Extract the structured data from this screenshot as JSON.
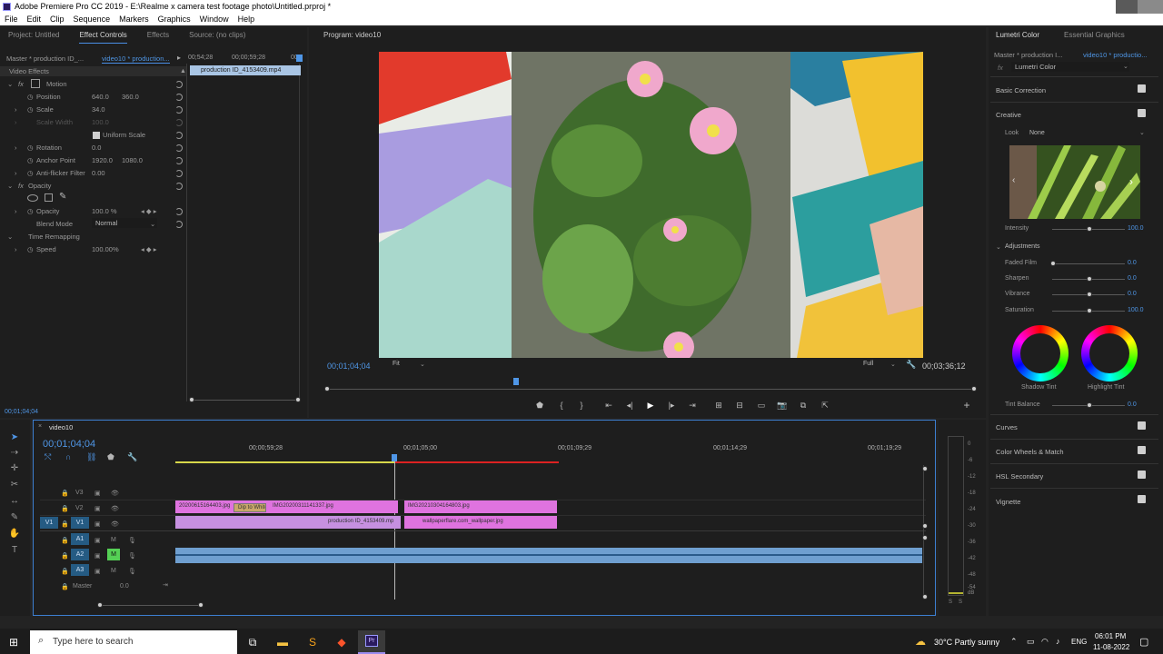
{
  "window": {
    "title": "Adobe Premiere Pro CC 2019 - E:\\Realme x camera test footage photo\\Untitled.prproj *"
  },
  "menu": [
    "File",
    "Edit",
    "Clip",
    "Sequence",
    "Markers",
    "Graphics",
    "Window",
    "Help"
  ],
  "left_panel": {
    "tabs": [
      "Project: Untitled",
      "Effect Controls",
      "Effects",
      "Source: (no clips)"
    ],
    "master": "Master * production ID_...",
    "sequence": "video10 * production...",
    "ruler": [
      "00;54;28",
      "00;00;59;28",
      "00"
    ],
    "clip_name": "production ID_4153409.mp4",
    "section": "Video Effects",
    "fx_motion": "Motion",
    "position_label": "Position",
    "position_x": "640.0",
    "position_y": "360.0",
    "scale_label": "Scale",
    "scale_val": "34.0",
    "scale_width_label": "Scale Width",
    "scale_width_val": "100.0",
    "uniform_scale": "Uniform Scale",
    "rotation_label": "Rotation",
    "rotation_val": "0.0",
    "anchor_label": "Anchor Point",
    "anchor_x": "1920.0",
    "anchor_y": "1080.0",
    "flicker_label": "Anti-flicker Filter",
    "flicker_val": "0.00",
    "fx_opacity": "Opacity",
    "opacity_label": "Opacity",
    "opacity_val": "100.0 %",
    "blend_label": "Blend Mode",
    "blend_val": "Normal",
    "time_remap": "Time Remapping",
    "speed_label": "Speed",
    "speed_val": "100.00%",
    "timecode": "00;01;04;04"
  },
  "program": {
    "title": "Program: video10",
    "timecode": "00;01;04;04",
    "fit": "Fit",
    "quality": "Full",
    "duration": "00;03;36;12"
  },
  "timeline": {
    "seq_tab": "video10",
    "timecode": "00;01;04;04",
    "ruler": [
      "00;00;59;28",
      "00;01;05;00",
      "00;01;09;29",
      "00;01;14;29",
      "00;01;19;29"
    ],
    "tracks": [
      "V3",
      "V2",
      "V1",
      "A1",
      "A2",
      "A3"
    ],
    "src_v1": "V1",
    "master_label": "Master",
    "master_val": "0.0",
    "clips": {
      "v2a": "20200615164403.jpg",
      "v2b": "Dip to White",
      "v2c": "IMG20200311141337.jpg",
      "v2d": "IMG20210304164803.jpg",
      "v1a": "production ID_4153409.mp",
      "v1b": "wallpaperflare.com_wallpaper.jpg"
    },
    "meter_scale": [
      "0",
      "-6",
      "-12",
      "-18",
      "-24",
      "-30",
      "-36",
      "-42",
      "-48",
      "-54",
      "dB"
    ],
    "meter_solo": [
      "S",
      "S"
    ]
  },
  "lumetri": {
    "tabs": [
      "Lumetri Color",
      "Essential Graphics"
    ],
    "master": "Master * production I...",
    "sequence": "video10 * productio...",
    "fx": "Lumetri Color",
    "sections": [
      "Basic Correction",
      "Creative",
      "Curves",
      "Color Wheels & Match",
      "HSL Secondary",
      "Vignette"
    ],
    "look_label": "Look",
    "look_val": "None",
    "intensity_label": "Intensity",
    "intensity_val": "100.0",
    "adjustments": "Adjustments",
    "adj": [
      {
        "label": "Faded Film",
        "val": "0.0"
      },
      {
        "label": "Sharpen",
        "val": "0.0"
      },
      {
        "label": "Vibrance",
        "val": "0.0"
      },
      {
        "label": "Saturation",
        "val": "100.0"
      }
    ],
    "shadow_tint": "Shadow Tint",
    "highlight_tint": "Highlight Tint",
    "tint_balance_label": "Tint Balance",
    "tint_balance_val": "0.0"
  },
  "taskbar": {
    "search_placeholder": "Type here to search",
    "weather": "30°C  Partly sunny",
    "lang": "ENG",
    "time": "06:01 PM",
    "date": "11-08-2022"
  },
  "colors": {
    "accent": "#4f96e6",
    "video_clip": "#df73df",
    "v1_clip": "#c690e0",
    "audio_clip": "#6f9fd0"
  }
}
